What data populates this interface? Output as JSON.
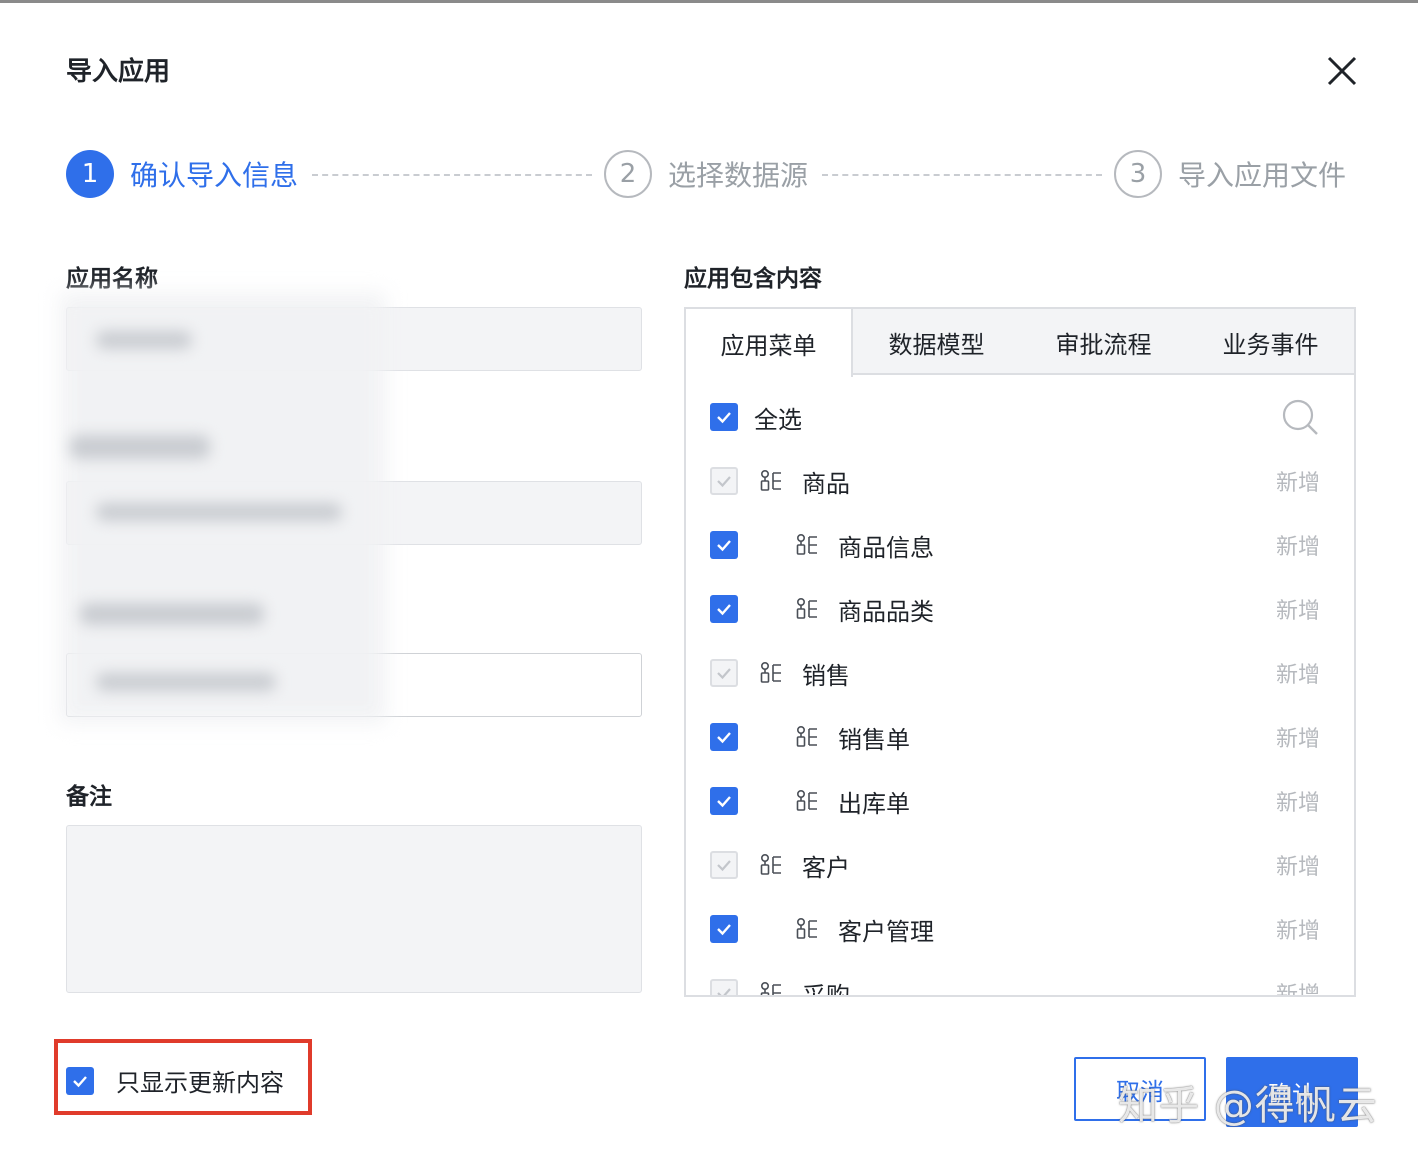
{
  "dialog": {
    "title": "导入应用"
  },
  "steps": [
    {
      "number": "1",
      "label": "确认导入信息",
      "state": "active"
    },
    {
      "number": "2",
      "label": "选择数据源",
      "state": "todo"
    },
    {
      "number": "3",
      "label": "导入应用文件",
      "state": "todo"
    }
  ],
  "form": {
    "app_name_label": "应用名称",
    "remark_label": "备注",
    "remark_value": ""
  },
  "content": {
    "label": "应用包含内容",
    "tabs": [
      "应用菜单",
      "数据模型",
      "审批流程",
      "业务事件"
    ],
    "active_tab": 0,
    "select_all_label": "全选",
    "items": [
      {
        "name": "商品",
        "status": "新增",
        "level": 0,
        "checkbox": "disabled"
      },
      {
        "name": "商品信息",
        "status": "新增",
        "level": 1,
        "checkbox": "checked"
      },
      {
        "name": "商品品类",
        "status": "新增",
        "level": 1,
        "checkbox": "checked"
      },
      {
        "name": "销售",
        "status": "新增",
        "level": 0,
        "checkbox": "disabled"
      },
      {
        "name": "销售单",
        "status": "新增",
        "level": 1,
        "checkbox": "checked"
      },
      {
        "name": "出库单",
        "status": "新增",
        "level": 1,
        "checkbox": "checked"
      },
      {
        "name": "客户",
        "status": "新增",
        "level": 0,
        "checkbox": "disabled"
      },
      {
        "name": "客户管理",
        "status": "新增",
        "level": 1,
        "checkbox": "checked"
      },
      {
        "name": "采购",
        "status": "新增",
        "level": 0,
        "checkbox": "disabled"
      }
    ]
  },
  "footer": {
    "only_updated_label": "只显示更新内容",
    "only_updated_checked": true,
    "cancel_label": "取消",
    "ok_label": "确认"
  },
  "watermark": "知乎 @得帆云",
  "colors": {
    "primary": "#2f6fea",
    "highlight": "#e03b2b",
    "muted": "#b6b9be"
  }
}
